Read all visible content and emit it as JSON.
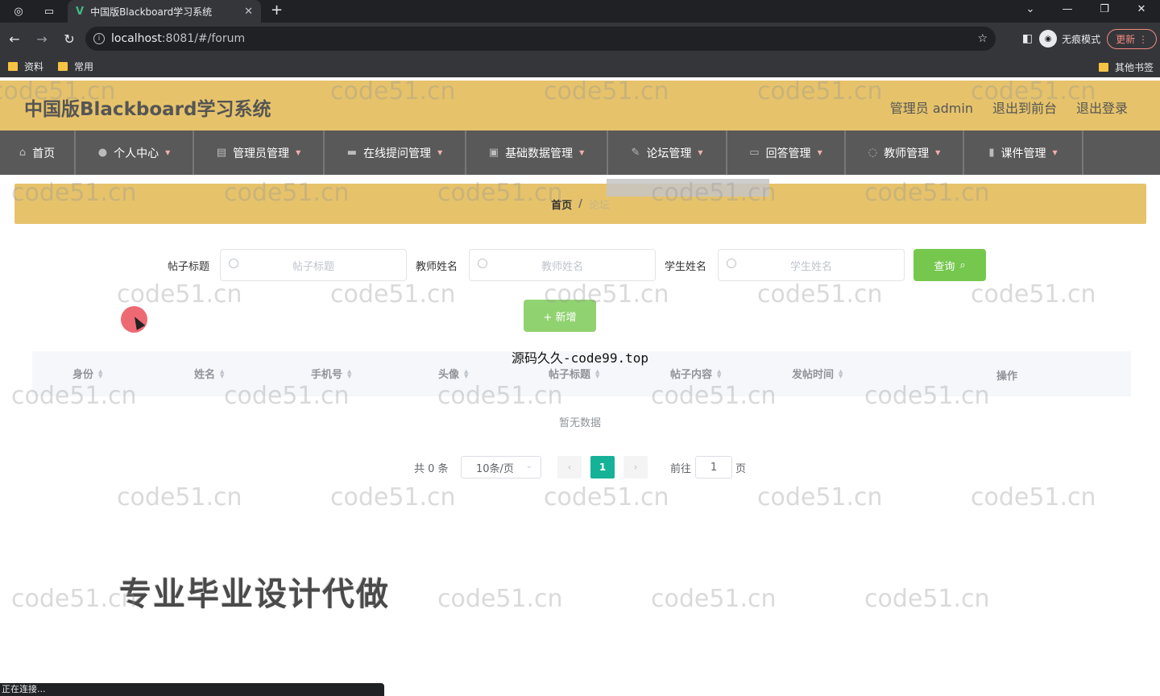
{
  "browser": {
    "tab_title": "中国版Blackboard学习系统",
    "url_host": "localhost",
    "url_rest": ":8081/#/forum",
    "incognito_label": "无痕模式",
    "update_label": "更新",
    "bookmarks": [
      "资料",
      "常用"
    ],
    "other_bookmarks": "其他书签"
  },
  "app": {
    "title": "中国版Blackboard学习系统",
    "header_links": [
      "管理员 admin",
      "退出到前台",
      "退出登录"
    ]
  },
  "menu": [
    {
      "label": "首页",
      "icon": "home-icon"
    },
    {
      "label": "个人中心",
      "icon": "user-icon"
    },
    {
      "label": "管理员管理",
      "icon": "admin-icon"
    },
    {
      "label": "在线提问管理",
      "icon": "question-icon"
    },
    {
      "label": "基础数据管理",
      "icon": "data-icon"
    },
    {
      "label": "论坛管理",
      "icon": "forum-icon"
    },
    {
      "label": "回答管理",
      "icon": "answer-icon"
    },
    {
      "label": "教师管理",
      "icon": "teacher-icon"
    },
    {
      "label": "课件管理",
      "icon": "chart-icon"
    }
  ],
  "breadcrumb": {
    "home": "首页",
    "sep": "/",
    "current": "论坛"
  },
  "search": {
    "fields": [
      {
        "label": "帖子标题",
        "placeholder": "帖子标题"
      },
      {
        "label": "教师姓名",
        "placeholder": "教师姓名"
      },
      {
        "label": "学生姓名",
        "placeholder": "学生姓名"
      }
    ],
    "search_button": "查询",
    "add_button": "+ 新增"
  },
  "table": {
    "columns": [
      "身份",
      "姓名",
      "手机号",
      "头像",
      "帖子标题",
      "帖子内容",
      "发帖时间",
      "操作"
    ],
    "empty_text": "暂无数据"
  },
  "pagination": {
    "total_text": "共 0 条",
    "page_size": "10条/页",
    "prev": "‹",
    "current_page": "1",
    "next": "›",
    "goto_label": "前往",
    "goto_value": "1",
    "page_suffix": "页"
  },
  "overlays": {
    "source": "源码久久-code99.top",
    "promo": "专业毕业设计代做",
    "watermark": "code51.cn"
  },
  "status_bar": "正在连接..."
}
